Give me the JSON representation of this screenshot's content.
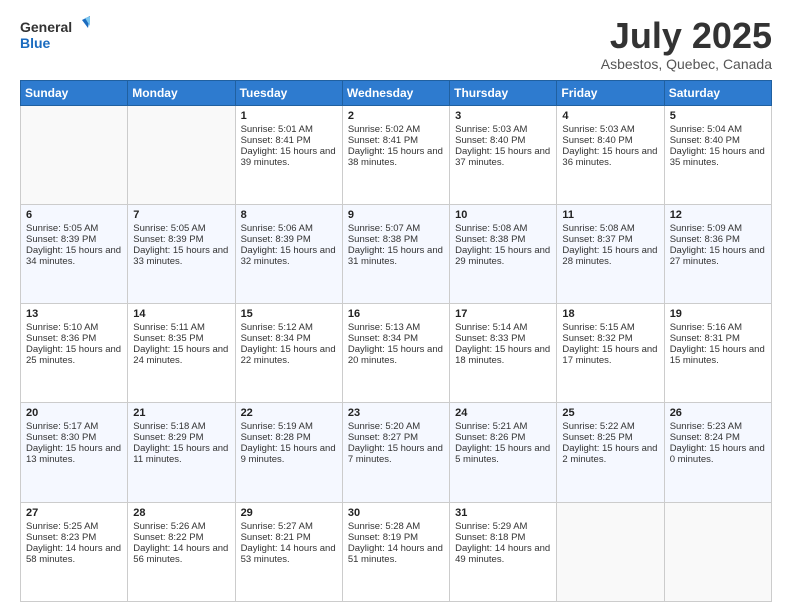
{
  "logo": {
    "line1": "General",
    "line2": "Blue"
  },
  "title": "July 2025",
  "subtitle": "Asbestos, Quebec, Canada",
  "days_header": [
    "Sunday",
    "Monday",
    "Tuesday",
    "Wednesday",
    "Thursday",
    "Friday",
    "Saturday"
  ],
  "weeks": [
    [
      {
        "day": "",
        "sunrise": "",
        "sunset": "",
        "daylight": ""
      },
      {
        "day": "",
        "sunrise": "",
        "sunset": "",
        "daylight": ""
      },
      {
        "day": "1",
        "sunrise": "Sunrise: 5:01 AM",
        "sunset": "Sunset: 8:41 PM",
        "daylight": "Daylight: 15 hours and 39 minutes."
      },
      {
        "day": "2",
        "sunrise": "Sunrise: 5:02 AM",
        "sunset": "Sunset: 8:41 PM",
        "daylight": "Daylight: 15 hours and 38 minutes."
      },
      {
        "day": "3",
        "sunrise": "Sunrise: 5:03 AM",
        "sunset": "Sunset: 8:40 PM",
        "daylight": "Daylight: 15 hours and 37 minutes."
      },
      {
        "day": "4",
        "sunrise": "Sunrise: 5:03 AM",
        "sunset": "Sunset: 8:40 PM",
        "daylight": "Daylight: 15 hours and 36 minutes."
      },
      {
        "day": "5",
        "sunrise": "Sunrise: 5:04 AM",
        "sunset": "Sunset: 8:40 PM",
        "daylight": "Daylight: 15 hours and 35 minutes."
      }
    ],
    [
      {
        "day": "6",
        "sunrise": "Sunrise: 5:05 AM",
        "sunset": "Sunset: 8:39 PM",
        "daylight": "Daylight: 15 hours and 34 minutes."
      },
      {
        "day": "7",
        "sunrise": "Sunrise: 5:05 AM",
        "sunset": "Sunset: 8:39 PM",
        "daylight": "Daylight: 15 hours and 33 minutes."
      },
      {
        "day": "8",
        "sunrise": "Sunrise: 5:06 AM",
        "sunset": "Sunset: 8:39 PM",
        "daylight": "Daylight: 15 hours and 32 minutes."
      },
      {
        "day": "9",
        "sunrise": "Sunrise: 5:07 AM",
        "sunset": "Sunset: 8:38 PM",
        "daylight": "Daylight: 15 hours and 31 minutes."
      },
      {
        "day": "10",
        "sunrise": "Sunrise: 5:08 AM",
        "sunset": "Sunset: 8:38 PM",
        "daylight": "Daylight: 15 hours and 29 minutes."
      },
      {
        "day": "11",
        "sunrise": "Sunrise: 5:08 AM",
        "sunset": "Sunset: 8:37 PM",
        "daylight": "Daylight: 15 hours and 28 minutes."
      },
      {
        "day": "12",
        "sunrise": "Sunrise: 5:09 AM",
        "sunset": "Sunset: 8:36 PM",
        "daylight": "Daylight: 15 hours and 27 minutes."
      }
    ],
    [
      {
        "day": "13",
        "sunrise": "Sunrise: 5:10 AM",
        "sunset": "Sunset: 8:36 PM",
        "daylight": "Daylight: 15 hours and 25 minutes."
      },
      {
        "day": "14",
        "sunrise": "Sunrise: 5:11 AM",
        "sunset": "Sunset: 8:35 PM",
        "daylight": "Daylight: 15 hours and 24 minutes."
      },
      {
        "day": "15",
        "sunrise": "Sunrise: 5:12 AM",
        "sunset": "Sunset: 8:34 PM",
        "daylight": "Daylight: 15 hours and 22 minutes."
      },
      {
        "day": "16",
        "sunrise": "Sunrise: 5:13 AM",
        "sunset": "Sunset: 8:34 PM",
        "daylight": "Daylight: 15 hours and 20 minutes."
      },
      {
        "day": "17",
        "sunrise": "Sunrise: 5:14 AM",
        "sunset": "Sunset: 8:33 PM",
        "daylight": "Daylight: 15 hours and 18 minutes."
      },
      {
        "day": "18",
        "sunrise": "Sunrise: 5:15 AM",
        "sunset": "Sunset: 8:32 PM",
        "daylight": "Daylight: 15 hours and 17 minutes."
      },
      {
        "day": "19",
        "sunrise": "Sunrise: 5:16 AM",
        "sunset": "Sunset: 8:31 PM",
        "daylight": "Daylight: 15 hours and 15 minutes."
      }
    ],
    [
      {
        "day": "20",
        "sunrise": "Sunrise: 5:17 AM",
        "sunset": "Sunset: 8:30 PM",
        "daylight": "Daylight: 15 hours and 13 minutes."
      },
      {
        "day": "21",
        "sunrise": "Sunrise: 5:18 AM",
        "sunset": "Sunset: 8:29 PM",
        "daylight": "Daylight: 15 hours and 11 minutes."
      },
      {
        "day": "22",
        "sunrise": "Sunrise: 5:19 AM",
        "sunset": "Sunset: 8:28 PM",
        "daylight": "Daylight: 15 hours and 9 minutes."
      },
      {
        "day": "23",
        "sunrise": "Sunrise: 5:20 AM",
        "sunset": "Sunset: 8:27 PM",
        "daylight": "Daylight: 15 hours and 7 minutes."
      },
      {
        "day": "24",
        "sunrise": "Sunrise: 5:21 AM",
        "sunset": "Sunset: 8:26 PM",
        "daylight": "Daylight: 15 hours and 5 minutes."
      },
      {
        "day": "25",
        "sunrise": "Sunrise: 5:22 AM",
        "sunset": "Sunset: 8:25 PM",
        "daylight": "Daylight: 15 hours and 2 minutes."
      },
      {
        "day": "26",
        "sunrise": "Sunrise: 5:23 AM",
        "sunset": "Sunset: 8:24 PM",
        "daylight": "Daylight: 15 hours and 0 minutes."
      }
    ],
    [
      {
        "day": "27",
        "sunrise": "Sunrise: 5:25 AM",
        "sunset": "Sunset: 8:23 PM",
        "daylight": "Daylight: 14 hours and 58 minutes."
      },
      {
        "day": "28",
        "sunrise": "Sunrise: 5:26 AM",
        "sunset": "Sunset: 8:22 PM",
        "daylight": "Daylight: 14 hours and 56 minutes."
      },
      {
        "day": "29",
        "sunrise": "Sunrise: 5:27 AM",
        "sunset": "Sunset: 8:21 PM",
        "daylight": "Daylight: 14 hours and 53 minutes."
      },
      {
        "day": "30",
        "sunrise": "Sunrise: 5:28 AM",
        "sunset": "Sunset: 8:19 PM",
        "daylight": "Daylight: 14 hours and 51 minutes."
      },
      {
        "day": "31",
        "sunrise": "Sunrise: 5:29 AM",
        "sunset": "Sunset: 8:18 PM",
        "daylight": "Daylight: 14 hours and 49 minutes."
      },
      {
        "day": "",
        "sunrise": "",
        "sunset": "",
        "daylight": ""
      },
      {
        "day": "",
        "sunrise": "",
        "sunset": "",
        "daylight": ""
      }
    ]
  ]
}
